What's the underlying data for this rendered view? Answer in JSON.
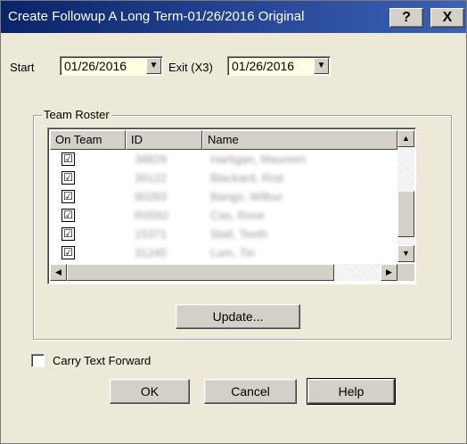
{
  "window": {
    "title": "Create Followup A Long Term-01/26/2016 Original",
    "help_button": "?",
    "close_button": "X"
  },
  "dates": {
    "start_label": "Start",
    "start_value": "01/26/2016",
    "exit_label": "Exit (X3)",
    "exit_value": "01/26/2016"
  },
  "roster": {
    "group_label": "Team Roster",
    "columns": [
      "On Team",
      "ID",
      "Name"
    ],
    "rows": [
      {
        "checked": true,
        "id": "38829",
        "name": "Hartigan, Maureen"
      },
      {
        "checked": true,
        "id": "39122",
        "name": "Blackard, Rod"
      },
      {
        "checked": true,
        "id": "90283",
        "name": "Bangs, Wilbur"
      },
      {
        "checked": true,
        "id": "R0582",
        "name": "Cas, Rose"
      },
      {
        "checked": true,
        "id": "15371",
        "name": "Stall, Teeth"
      },
      {
        "checked": true,
        "id": "31245",
        "name": "Lum, Tin"
      }
    ],
    "update_button": "Update..."
  },
  "options": {
    "carry_text_forward": "Carry Text Forward",
    "carry_text_checked": false
  },
  "buttons": {
    "ok": "OK",
    "cancel": "Cancel",
    "help": "Help"
  },
  "icons": {
    "check": "☑",
    "arrow_down": "▼",
    "arrow_up": "▲",
    "arrow_left": "◀",
    "arrow_right": "▶"
  }
}
